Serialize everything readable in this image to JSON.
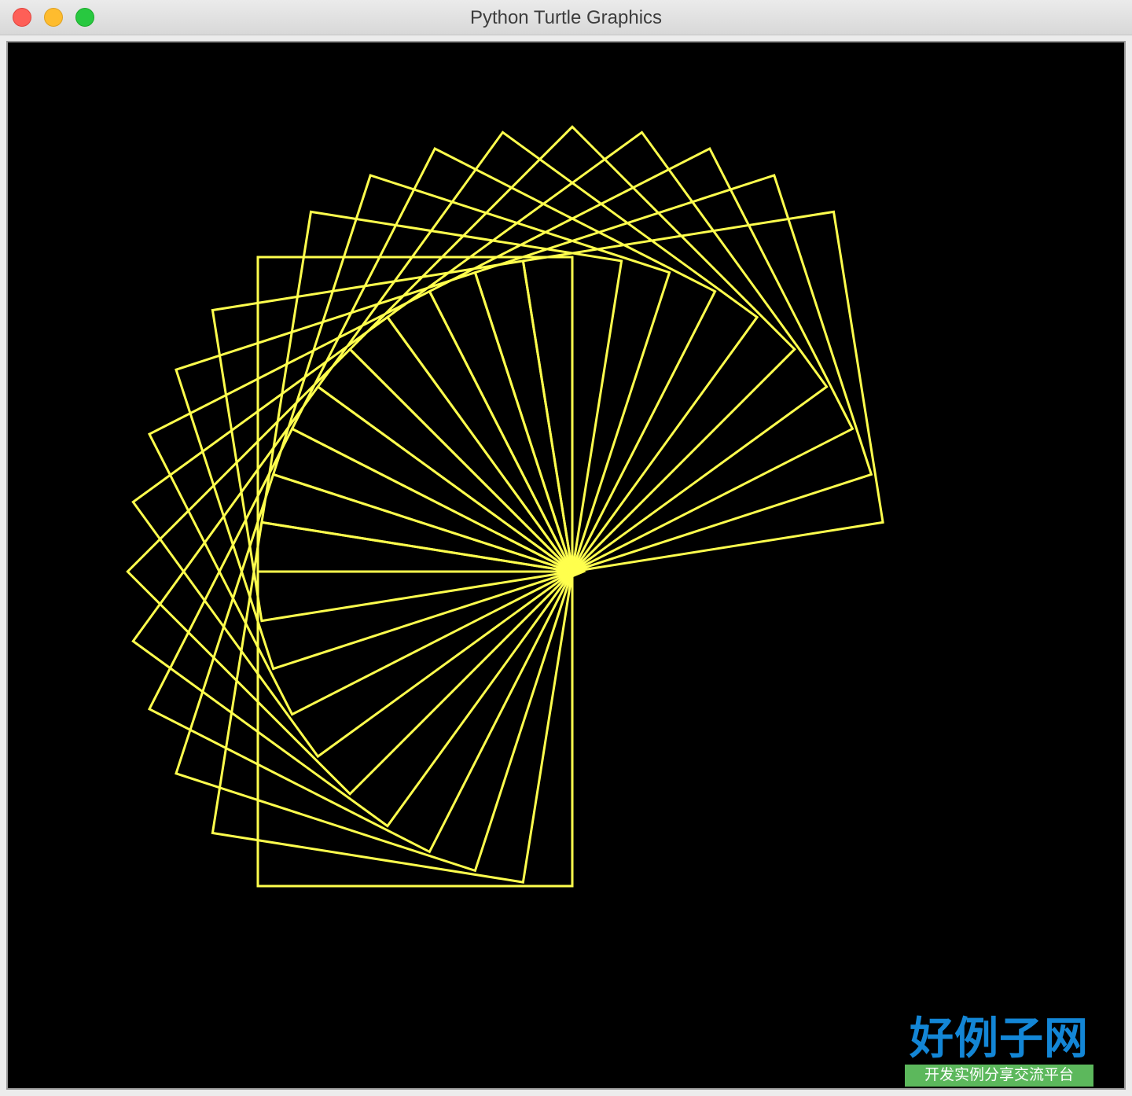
{
  "window": {
    "title": "Python Turtle Graphics"
  },
  "canvas": {
    "background": "#000000",
    "stroke_color": "#ffff4d"
  },
  "watermark": {
    "main": "好例子网",
    "sub": "开发实例分享交流平台",
    "main_color": "#1386d6",
    "sub_bg": "#5cb85c"
  },
  "drawing": {
    "squares": 20,
    "turn_degrees": 9
  }
}
